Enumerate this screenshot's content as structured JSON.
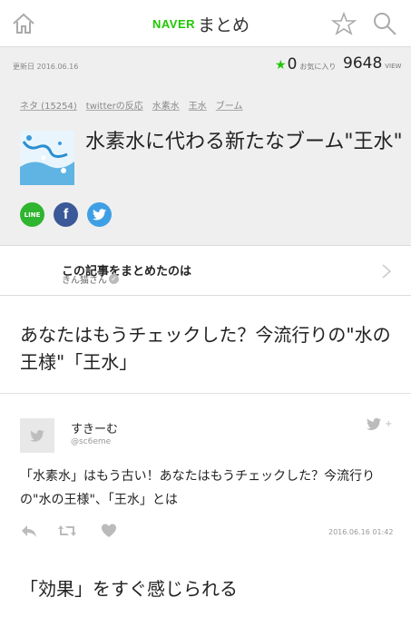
{
  "header": {
    "logo_naver": "NAVER",
    "logo_matome": "まとめ",
    "icons": [
      "home-icon",
      "star-icon",
      "search-icon"
    ]
  },
  "summary": {
    "updated": "更新日 2016.06.16",
    "fav_count": "0",
    "fav_label": "お気に入り",
    "view_count": "9648",
    "view_label": "VIEW",
    "tags": [
      "ネタ (15254)",
      "twitterの反応",
      "水素水",
      "王水",
      "ブーム"
    ],
    "title": "水素水に代わる新たなブーム\"王水\"",
    "share_icons": [
      "line-icon",
      "facebook-icon",
      "twitter-icon"
    ],
    "line_label": "LINE",
    "fb_label": "f"
  },
  "author": {
    "heading": "この記事をまとめたのは",
    "name": "きん猫さん"
  },
  "section_heading": "あなたはもうチェックした？今流行りの\"水の王様\"「王水」",
  "tweet": {
    "name": "すきーむ",
    "handle": "@sc6eme",
    "text": "「水素水」はもう古い！あなたはもうチェックした？今流行りの\"水の王様\"、「王水」とは",
    "date": "2016.06.16 01:42",
    "action_icons": [
      "reply-icon",
      "retweet-icon",
      "like-icon"
    ]
  },
  "effect_heading": "「効果」をすぐ感じられる",
  "colors": {
    "brand": "#1ec800",
    "gray_bg": "#efefef",
    "twitter": "#3f9fe4",
    "facebook": "#3b5998",
    "line": "#2fb52f"
  }
}
